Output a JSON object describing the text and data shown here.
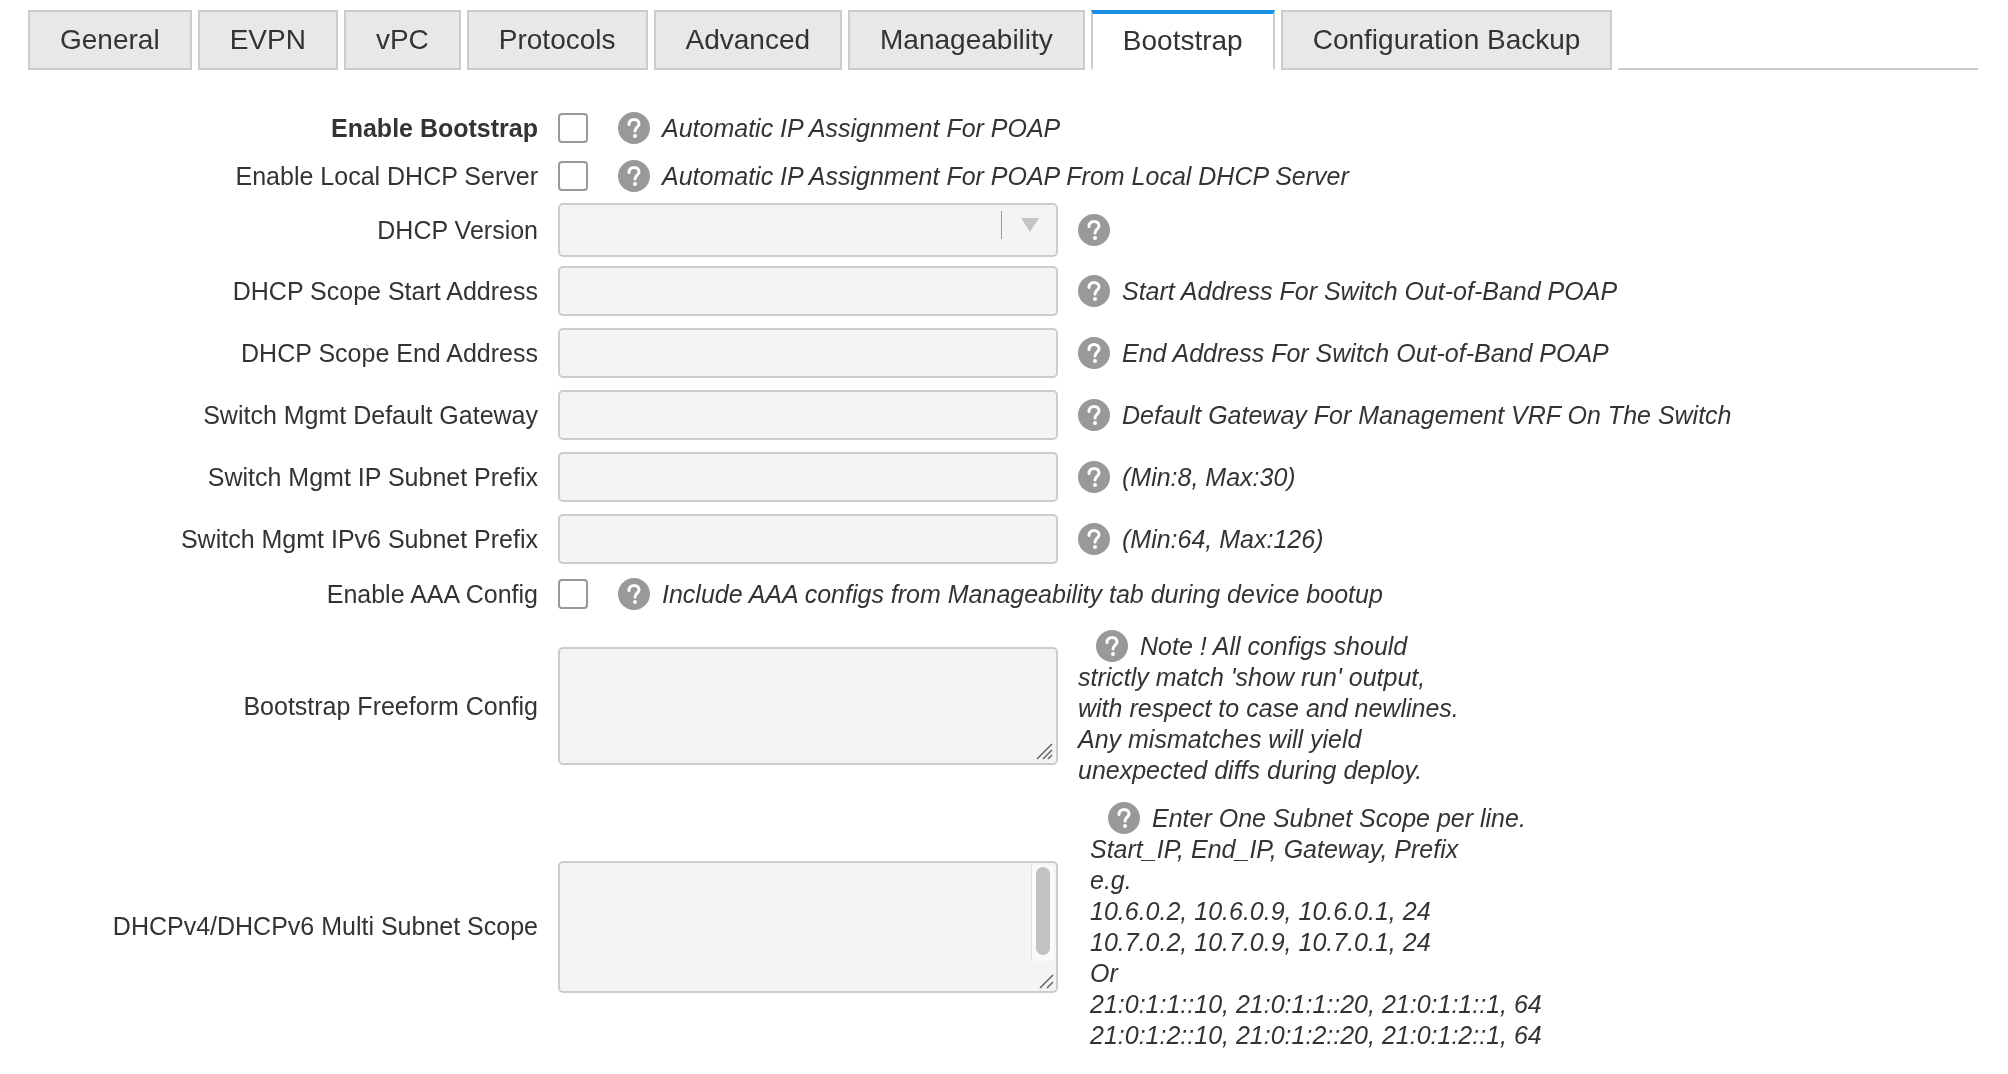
{
  "tabs": [
    {
      "label": "General",
      "selected": false
    },
    {
      "label": "EVPN",
      "selected": false
    },
    {
      "label": "vPC",
      "selected": false
    },
    {
      "label": "Protocols",
      "selected": false
    },
    {
      "label": "Advanced",
      "selected": false
    },
    {
      "label": "Manageability",
      "selected": false
    },
    {
      "label": "Bootstrap",
      "selected": true
    },
    {
      "label": "Configuration Backup",
      "selected": false
    }
  ],
  "fields": [
    {
      "kind": "checkbox",
      "label": "Enable Bootstrap",
      "emphasized": true,
      "checked": false,
      "help": "Automatic IP Assignment For POAP"
    },
    {
      "kind": "checkbox",
      "label": "Enable Local DHCP Server",
      "emphasized": false,
      "checked": false,
      "help": "Automatic IP Assignment For POAP From Local DHCP Server"
    },
    {
      "kind": "select",
      "label": "DHCP Version",
      "emphasized": false
    },
    {
      "kind": "text",
      "label": "DHCP Scope Start Address",
      "emphasized": false,
      "help": "Start Address For Switch Out-of-Band POAP"
    },
    {
      "kind": "text",
      "label": "DHCP Scope End Address",
      "emphasized": false,
      "help": "End Address For Switch Out-of-Band POAP"
    },
    {
      "kind": "text",
      "label": "Switch Mgmt Default Gateway",
      "emphasized": false,
      "help": "Default Gateway For Management VRF On The Switch"
    },
    {
      "kind": "text",
      "label": "Switch Mgmt IP Subnet Prefix",
      "emphasized": false,
      "help": "(Min:8, Max:30)"
    },
    {
      "kind": "text",
      "label": "Switch Mgmt IPv6 Subnet Prefix",
      "emphasized": false,
      "help": "(Min:64, Max:126)"
    },
    {
      "kind": "checkbox",
      "label": "Enable AAA Config",
      "emphasized": false,
      "checked": false,
      "help": "Include AAA configs from Manageability tab during device bootup"
    },
    {
      "kind": "textarea",
      "label": "Bootstrap Freeform Config",
      "emphasized": false,
      "help": "Note ! All configs should",
      "help_more": "strictly match 'show run' output,\nwith respect to case and newlines.\nAny mismatches will yield\nunexpected diffs during deploy."
    },
    {
      "kind": "scroll-textarea",
      "label": "DHCPv4/DHCPv6 Multi Subnet Scope",
      "emphasized": false,
      "help": "Enter One Subnet Scope per line.",
      "help_more": "Start_IP, End_IP, Gateway, Prefix\ne.g.\n10.6.0.2, 10.6.0.9, 10.6.0.1, 24\n10.7.0.2, 10.7.0.9, 10.7.0.1, 24\nOr\n21:0:1:1::10, 21:0:1:1::20, 21:0:1:1::1, 64\n21:0:1:2::10, 21:0:1:2::20, 21:0:1:2::1, 64"
    }
  ]
}
